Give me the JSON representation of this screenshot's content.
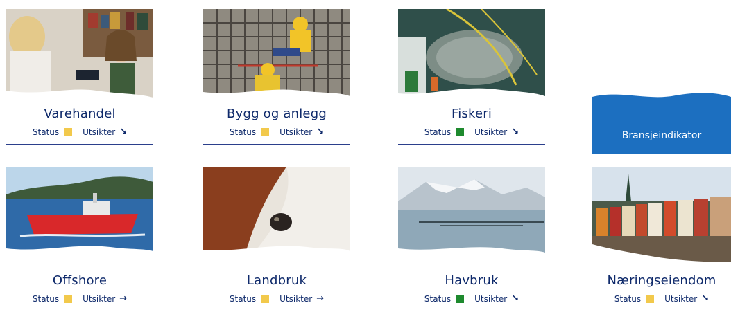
{
  "colors": {
    "navy": "#0f2a6b",
    "status_yellow": "#f2c94c",
    "status_green": "#1e8a2e",
    "indicator_blue": "#1c6fc0"
  },
  "cards": [
    {
      "title": "Varehandel",
      "status_label": "Status",
      "status_color": "#f2c94c",
      "outlook_label": "Utsikter",
      "outlook_icon": "arrow-down-right-icon",
      "outlook_glyph": "↘"
    },
    {
      "title": "Bygg og anlegg",
      "status_label": "Status",
      "status_color": "#f2c94c",
      "outlook_label": "Utsikter",
      "outlook_icon": "arrow-down-right-icon",
      "outlook_glyph": "↘"
    },
    {
      "title": "Fiskeri",
      "status_label": "Status",
      "status_color": "#1e8a2e",
      "outlook_label": "Utsikter",
      "outlook_icon": "arrow-down-right-icon",
      "outlook_glyph": "↘"
    },
    {
      "title": "Offshore",
      "status_label": "Status",
      "status_color": "#f2c94c",
      "outlook_label": "Utsikter",
      "outlook_icon": "arrow-right-icon",
      "outlook_glyph": "→"
    },
    {
      "title": "Landbruk",
      "status_label": "Status",
      "status_color": "#f2c94c",
      "outlook_label": "Utsikter",
      "outlook_icon": "arrow-right-icon",
      "outlook_glyph": "→"
    },
    {
      "title": "Havbruk",
      "status_label": "Status",
      "status_color": "#1e8a2e",
      "outlook_label": "Utsikter",
      "outlook_icon": "arrow-down-right-icon",
      "outlook_glyph": "↘"
    },
    {
      "title": "Næringseiendom",
      "status_label": "Status",
      "status_color": "#f2c94c",
      "outlook_label": "Utsikter",
      "outlook_icon": "arrow-down-right-icon",
      "outlook_glyph": "↘"
    }
  ],
  "indicator": {
    "label": "Bransjeindikator"
  }
}
